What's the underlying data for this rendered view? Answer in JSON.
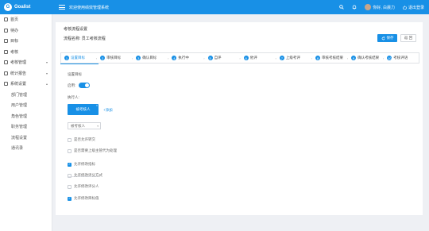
{
  "header": {
    "brand": "Goalist",
    "logo_glyph": "G",
    "system_title": "欢迎使用绩效管理系统",
    "user_name": "你好, 白晨力",
    "logout_label": "退出登录",
    "colors": {
      "primary": "#1890e6"
    }
  },
  "sidebar": {
    "items": [
      {
        "label": "首页",
        "icon": "home-icon"
      },
      {
        "label": "待办",
        "icon": "todo-icon"
      },
      {
        "label": "目标",
        "icon": "target-icon"
      },
      {
        "label": "考核",
        "icon": "assessment-icon"
      },
      {
        "label": "考核管理",
        "icon": "manage-icon",
        "chevron": "▾"
      },
      {
        "label": "统计报告",
        "icon": "report-icon",
        "chevron": "▾"
      },
      {
        "label": "系统设置",
        "icon": "settings-icon",
        "chevron": "▴"
      }
    ],
    "subitems": [
      "部门管理",
      "用户管理",
      "角色管理",
      "职务管理",
      "流程设置",
      "通讯录"
    ]
  },
  "panel": {
    "title": "考核流程设置",
    "flow_name_label": "流程名称:",
    "flow_name_value": "员工考核流程",
    "save_label": "保存",
    "back_label": "返 回"
  },
  "steps": [
    {
      "num": "1",
      "label": "设置目标"
    },
    {
      "num": "2",
      "label": "审核目标"
    },
    {
      "num": "3",
      "label": "确认目标"
    },
    {
      "num": "4",
      "label": "执行中"
    },
    {
      "num": "5",
      "label": "自评"
    },
    {
      "num": "6",
      "label": "他评"
    },
    {
      "num": "7",
      "label": "上级考评"
    },
    {
      "num": "8",
      "label": "审核考核结果"
    },
    {
      "num": "9",
      "label": "确认考核结果"
    },
    {
      "num": "10",
      "label": "考核评语"
    }
  ],
  "form": {
    "section_label": "设置目标",
    "enable_label": "启用:",
    "enabled": true,
    "executor_label": "执行人:",
    "executor_value": "被考核人",
    "add_link": "+添加",
    "select_value": "被考核人",
    "options": [
      {
        "label": "是否允许转交",
        "checked": false
      },
      {
        "label": "是否需要上级主管代为处理",
        "checked": false
      },
      {
        "label": "允许修改指标",
        "checked": true
      },
      {
        "label": "允许修改评分方式",
        "checked": false
      },
      {
        "label": "允许修改评分人",
        "checked": false
      },
      {
        "label": "允许修改目标值",
        "checked": true
      }
    ]
  }
}
